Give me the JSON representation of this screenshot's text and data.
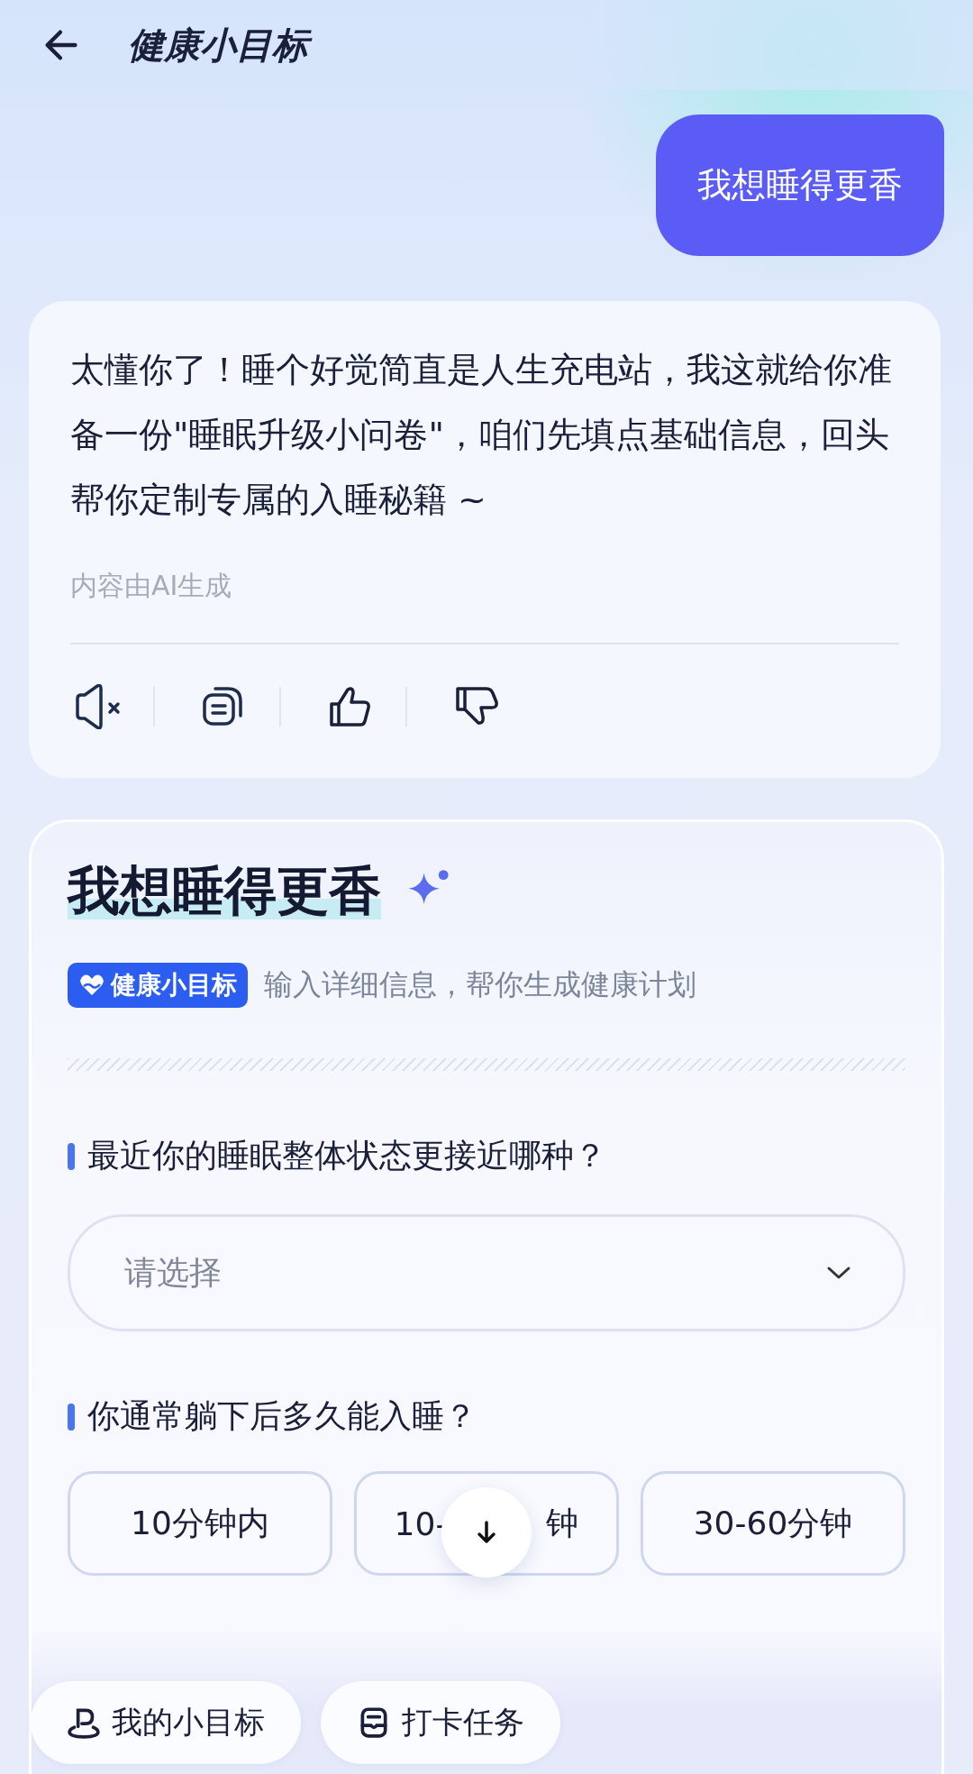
{
  "header": {
    "title": "健康小目标"
  },
  "user_message": "我想睡得更香",
  "reply": {
    "text": "太懂你了！睡个好觉简直是人生充电站，我这就给你准备一份\"睡眠升级小问卷\"，咱们先填点基础信息，回头帮你定制专属的入睡秘籍 ~",
    "note": "内容由AI生成"
  },
  "form": {
    "title": "我想睡得更香",
    "tag": "健康小目标",
    "subtitle": "输入详细信息，帮你生成健康计划",
    "questions": [
      {
        "kind": "select",
        "label": "最近你的睡眠整体状态更接近哪种？",
        "placeholder": "请选择"
      },
      {
        "kind": "options",
        "label": "你通常躺下后多久能入睡？",
        "options": [
          {
            "label": "10分钟内",
            "selected": false
          },
          {
            "label_parts": [
              "10-",
              "钟"
            ],
            "selected": false
          },
          {
            "label": "30-60分钟",
            "selected": false
          }
        ]
      }
    ]
  },
  "bottom_bar": [
    {
      "kind": "goals",
      "label": "我的小目标"
    },
    {
      "kind": "checkin",
      "label": "打卡任务"
    }
  ]
}
